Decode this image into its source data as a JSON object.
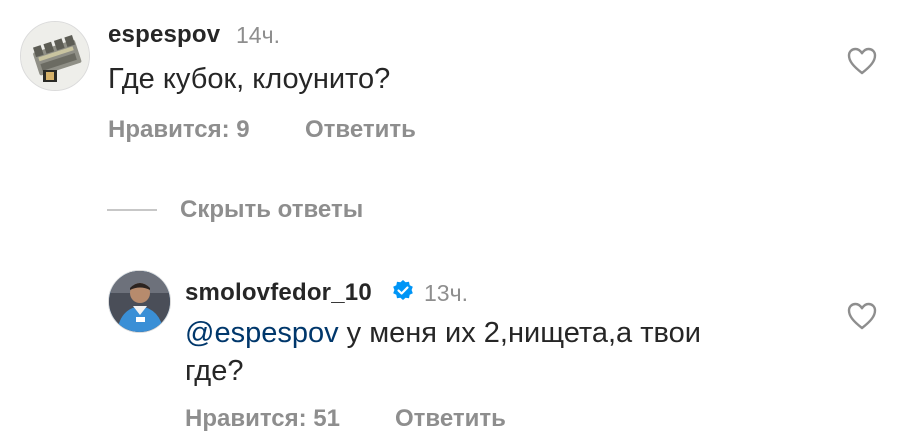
{
  "comments": [
    {
      "username": "espespov",
      "time": "14ч.",
      "text": "Где кубок, клоунито?",
      "likes_label": "Нравится: 9",
      "reply_label": "Ответить",
      "avatar_icon": "battery-holder-avatar"
    },
    {
      "username": "smolovfedor_10",
      "verified": true,
      "time": "13ч.",
      "mention": "@espespov",
      "text_line1": " у меня их 2,нищета,а твои",
      "text_line2": "где?",
      "likes_label": "Нравится: 51",
      "reply_label": "Ответить",
      "avatar_icon": "player-photo-avatar"
    }
  ],
  "replies_toggle": {
    "label": "Скрыть ответы"
  },
  "colors": {
    "text": "#262626",
    "secondary": "#8e8e8e",
    "mention": "#00376b",
    "verified": "#0095f6"
  }
}
